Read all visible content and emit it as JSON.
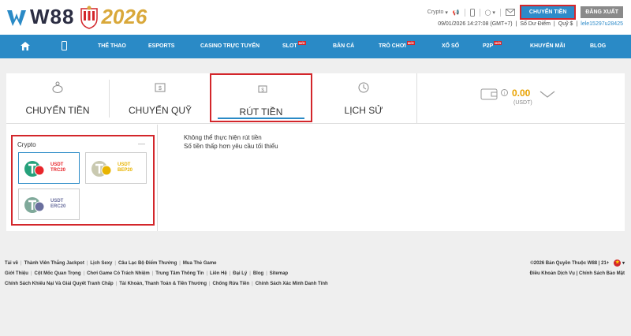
{
  "header": {
    "brand": "W88",
    "year": "2026",
    "currency_select": "Crypto",
    "transfer_button": "CHUYỂN TIỀN",
    "logout_button": "ĐĂNG XUẤT",
    "datetime": "09/01/2026 14:27:08 (GMT+7)",
    "points_label": "Số Dư Điểm",
    "fund_label": "Quỹ $",
    "username": "lele15297u28425"
  },
  "nav": {
    "items": [
      "THỂ THAO",
      "ESPORTS",
      "CASINO TRỰC TUYẾN",
      "SLOT",
      "BẮN CÁ",
      "TRÒ CHƠI",
      "XỔ SỐ",
      "P2P",
      "KHUYẾN MÃI",
      "BLOG"
    ],
    "hot_badge": "MỚI"
  },
  "tabs": [
    "CHUYỂN TIỀN",
    "CHUYỂN QUỸ",
    "RÚT TIỀN",
    "LỊCH SỬ"
  ],
  "active_tab": "RÚT TIỀN",
  "wallet": {
    "amount": "0.00",
    "unit": "(USDT)"
  },
  "crypto": {
    "title": "Crypto",
    "collapse": "—",
    "coins": [
      {
        "line1": "USDT",
        "line2": "TRC20",
        "color": "#e8262b"
      },
      {
        "line1": "USDT",
        "line2": "BEP20",
        "color": "#e8b400"
      },
      {
        "line1": "USDT",
        "line2": "ERC20",
        "color": "#6a6f9e"
      }
    ]
  },
  "messages": {
    "line1": "Không thể thực hiện rút tiền",
    "line2": "Số tiền thấp hơn yêu cầu tối thiểu"
  },
  "footer": {
    "row1": [
      "Tải về",
      "Thành Viên Thắng Jackpot",
      "Lịch Sexy",
      "Câu Lạc Bộ Điểm Thưởng",
      "Mua Thẻ Game"
    ],
    "row2": [
      "Giới Thiệu",
      "Cột Mốc Quan Trọng",
      "Chơi Game Có Trách Nhiệm",
      "Trung Tâm Thông Tin",
      "Liên Hệ",
      "Đại Lý",
      "Blog",
      "Sitemap"
    ],
    "row3": [
      "Chính Sách Khiếu Nại Và Giải Quyết Tranh Chấp",
      "Tài Khoản, Thanh Toán & Tiền Thưởng",
      "Chống Rửa Tiền",
      "Chính Sách Xác Minh Danh Tính"
    ],
    "copyright": "©2026 Bản Quyền Thuộc W88 | 21+",
    "terms": "Điều Khoản Dịch Vụ",
    "privacy": "Chính Sách Bảo Mật"
  },
  "colors": {
    "primary": "#2a8ac6",
    "highlight": "#d3262b",
    "gold": "#e8a200"
  }
}
